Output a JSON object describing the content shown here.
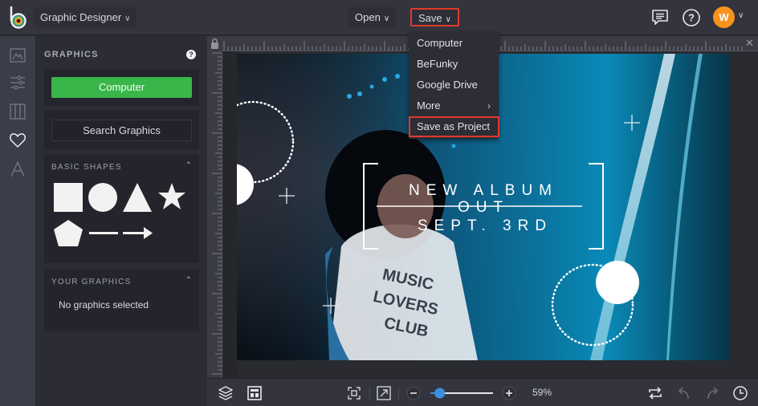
{
  "app": {
    "workspace_name": "Graphic Designer"
  },
  "topbar": {
    "open_label": "Open",
    "save_label": "Save",
    "avatar_initial": "W",
    "icons": [
      "chat-icon",
      "help-icon"
    ]
  },
  "save_menu": {
    "items": [
      {
        "label": "Computer"
      },
      {
        "label": "BeFunky"
      },
      {
        "label": "Google Drive"
      },
      {
        "label": "More",
        "submenu": true
      },
      {
        "label": "Save as Project",
        "highlighted": true
      }
    ]
  },
  "rail": {
    "items": [
      "image-icon",
      "sliders-icon",
      "columns-icon",
      "heart-icon",
      "text-icon"
    ],
    "active": "heart-icon"
  },
  "panel": {
    "title": "GRAPHICS",
    "computer_button": "Computer",
    "search_button": "Search Graphics",
    "basic_shapes": {
      "title": "BASIC SHAPES",
      "shapes": [
        "square",
        "circle",
        "triangle",
        "star",
        "pentagon",
        "line",
        "arrow"
      ]
    },
    "your_graphics": {
      "title": "YOUR GRAPHICS",
      "empty_text": "No graphics selected"
    }
  },
  "canvas": {
    "headline_line1": "NEW ALBUM",
    "headline_line2": "OUT",
    "headline_line3": "SEPT. 3RD",
    "shirt_text_1": "MUSIC",
    "shirt_text_2": "LOVERS",
    "shirt_text_3": "CLUB"
  },
  "bottombar": {
    "zoom_percent": "59%",
    "zoom_level": 0.15
  },
  "colors": {
    "accent_green": "#3ab54a",
    "highlight_red": "#e0392b",
    "avatar_orange": "#f7941d",
    "slider_blue": "#3b8fe0"
  }
}
